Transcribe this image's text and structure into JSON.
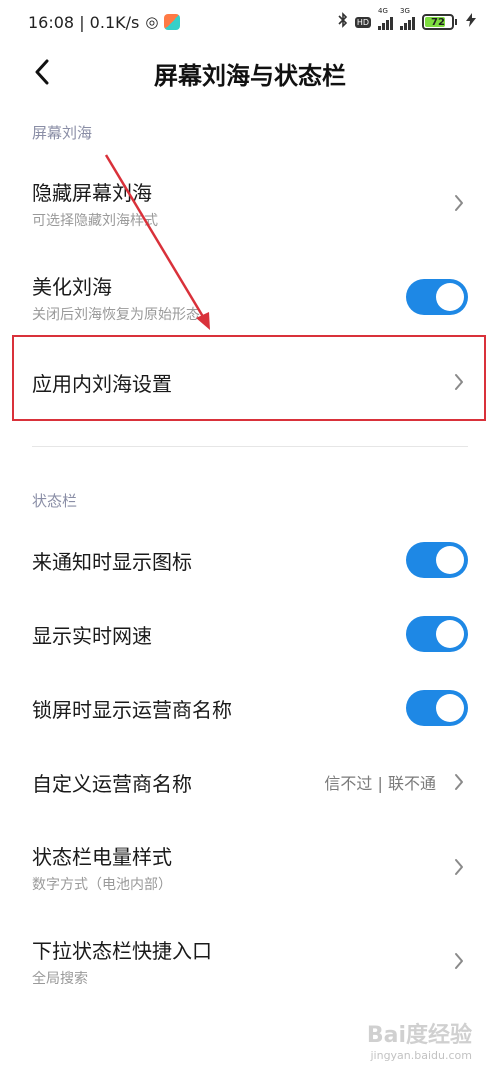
{
  "status_bar": {
    "time_speed": "16:08 | 0.1K/s",
    "hd": "HD",
    "sim1_label": "4G",
    "sim2_label": "3G",
    "battery": "72",
    "battery_level": 0.72
  },
  "header": {
    "title": "屏幕刘海与状态栏"
  },
  "sections": {
    "notch": "屏幕刘海",
    "status": "状态栏"
  },
  "rows": {
    "hide_notch": {
      "title": "隐藏屏幕刘海",
      "sub": "可选择隐藏刘海样式"
    },
    "beautify_notch": {
      "title": "美化刘海",
      "sub": "关闭后刘海恢复为原始形态",
      "on": true
    },
    "in_app_notch": {
      "title": "应用内刘海设置"
    },
    "notif_icons": {
      "title": "来通知时显示图标",
      "on": true
    },
    "net_speed": {
      "title": "显示实时网速",
      "on": true
    },
    "carrier_lock": {
      "title": "锁屏时显示运营商名称",
      "on": true
    },
    "custom_carrier": {
      "title": "自定义运营商名称",
      "value": "信不过 | 联不通"
    },
    "battery_style": {
      "title": "状态栏电量样式",
      "sub": "数字方式（电池内部）"
    },
    "pulldown": {
      "title": "下拉状态栏快捷入口",
      "sub": "全局搜索"
    }
  },
  "colors": {
    "accent": "#1e88e5",
    "highlight": "#d9313a"
  },
  "watermark": {
    "main": "Bai度经验",
    "sub": "jingyan.baidu.com"
  }
}
